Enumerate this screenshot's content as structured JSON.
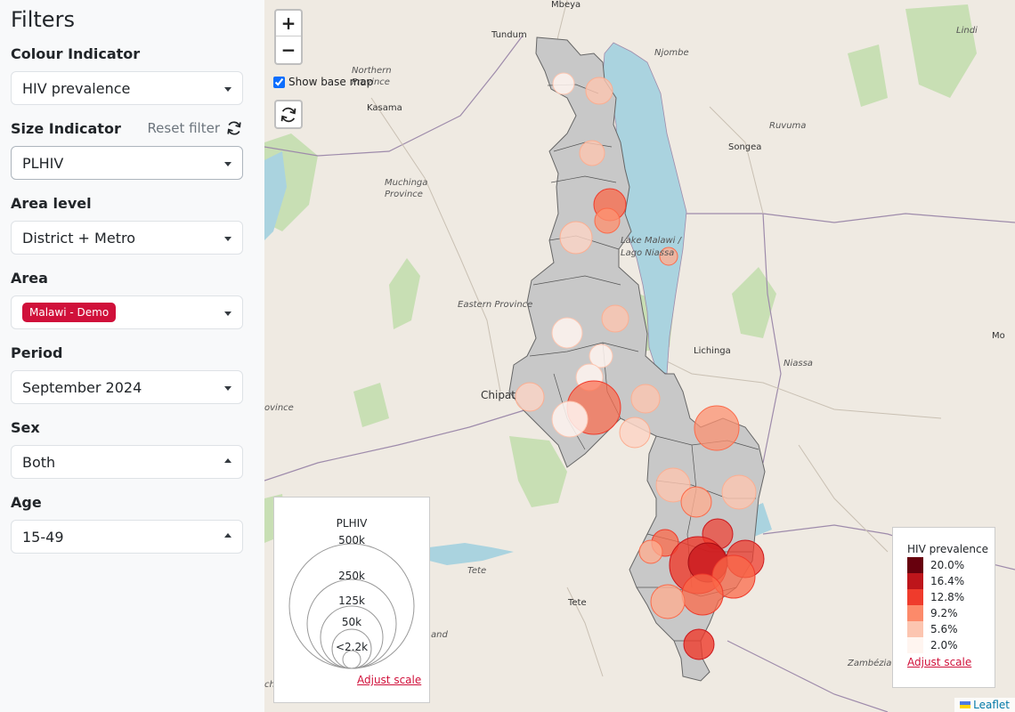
{
  "sidebar": {
    "title": "Filters",
    "reset_label": "Reset filter",
    "filters": {
      "colour": {
        "label": "Colour Indicator",
        "value": "HIV prevalence"
      },
      "size": {
        "label": "Size Indicator",
        "value": "PLHIV"
      },
      "area_level": {
        "label": "Area level",
        "value": "District + Metro"
      },
      "area": {
        "label": "Area",
        "value": "Malawi - Demo"
      },
      "period": {
        "label": "Period",
        "value": "September 2024"
      },
      "sex": {
        "label": "Sex",
        "value": "Both"
      },
      "age": {
        "label": "Age",
        "value": "15-49"
      }
    }
  },
  "map": {
    "zoom_in": "+",
    "zoom_out": "−",
    "basemap_label": "Show base map",
    "basemap_checked": true,
    "labels": {
      "mbeya": "Mbeya",
      "tunduma": "Tundum",
      "njombe": "Njombe",
      "lindi": "Lindi",
      "northern_province": "Northern Province",
      "kasama": "Kasama",
      "ruvuma": "Ruvuma",
      "songea": "Songea",
      "muchinga_province": "Muchinga Province",
      "lake_malawi": "Lake Malawi / Lago Niassa",
      "eastern_province": "Eastern Province",
      "lichinga": "Lichinga",
      "niassa": "Niassa",
      "chipata": "Chipat",
      "tete": "Tete",
      "tete_province": "Tete",
      "zambezia": "Zambézia",
      "province_left": "ovince",
      "mo": "Mo",
      "and": "and",
      "cho": "cho"
    },
    "attribution": "Leaflet"
  },
  "size_legend": {
    "title": "PLHIV",
    "levels": [
      "500k",
      "250k",
      "125k",
      "50k",
      "<2.2k"
    ],
    "adjust_label": "Adjust scale"
  },
  "colour_legend": {
    "title": "HIV prevalence",
    "items": [
      {
        "label": "20.0%",
        "color": "#67000d"
      },
      {
        "label": "16.4%",
        "color": "#bd151b"
      },
      {
        "label": "12.8%",
        "color": "#ef3b2c"
      },
      {
        "label": "9.2%",
        "color": "#fc8a6a"
      },
      {
        "label": "5.6%",
        "color": "#fcc5b0"
      },
      {
        "label": "2.0%",
        "color": "#fff5f0"
      }
    ],
    "adjust_label": "Adjust scale"
  }
}
